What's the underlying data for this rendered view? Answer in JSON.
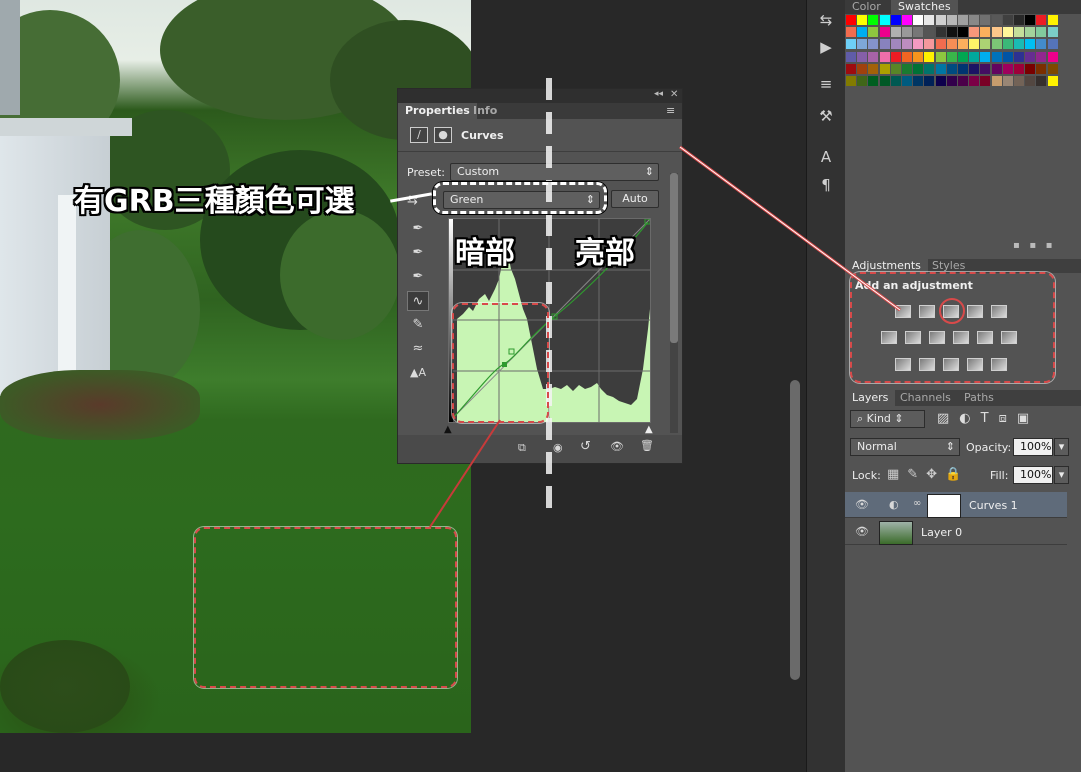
{
  "annotations": {
    "channel_note": "有GRB三種顏色可選",
    "shadows": "暗部",
    "highlights": "亮部"
  },
  "properties_panel": {
    "tabs": [
      "Properties",
      "Info"
    ],
    "title": "Curves",
    "preset_label": "Preset:",
    "preset_value": "Custom",
    "channel_value": "Green",
    "auto_label": "Auto"
  },
  "right_panel": {
    "swatch_tabs": [
      "Color",
      "Swatches"
    ],
    "adjust_tabs": [
      "Adjustments",
      "Styles"
    ],
    "add_adjustment": "Add an adjustment",
    "layer_tabs": [
      "Layers",
      "Channels",
      "Paths"
    ],
    "kind_label": "Kind",
    "blend_mode": "Normal",
    "opacity_label": "Opacity:",
    "opacity_value": "100%",
    "lock_label": "Lock:",
    "fill_label": "Fill:",
    "fill_value": "100%",
    "layers": [
      {
        "name": "Curves 1"
      },
      {
        "name": "Layer 0"
      }
    ]
  },
  "colors": {
    "accent_red": "#d84a4a",
    "histogram_fill": "#c8f5b4",
    "curve_green": "#2e9a2e"
  },
  "icons": [
    "pan-icon",
    "play-icon",
    "tools-icon",
    "character-icon",
    "paragraph-icon",
    "eyedropper-icon",
    "curve-icon",
    "pencil-icon",
    "visibility-icon",
    "trash-icon"
  ]
}
